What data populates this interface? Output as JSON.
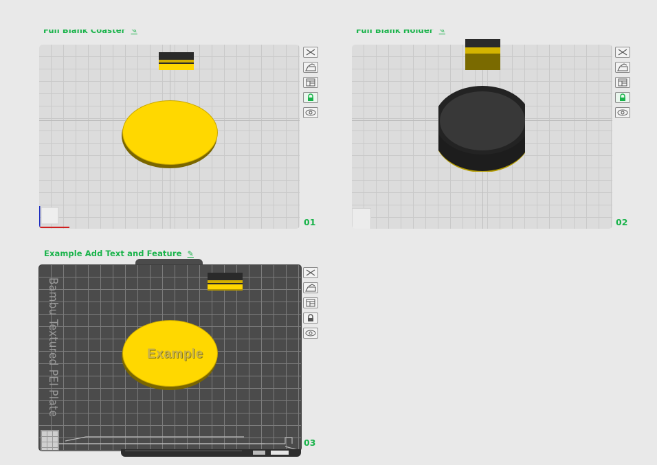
{
  "plates": [
    {
      "name": "Full Blank Coaster",
      "number": "01",
      "object_color": "#ffd700",
      "locked": true
    },
    {
      "name": "Full Blank Holder",
      "number": "02",
      "object_color": "#2e2e2e",
      "locked": true
    },
    {
      "name": "Example Add Text and Feature",
      "number": "03",
      "object_color": "#ffd700",
      "locked": false,
      "bed_label": "Bambu Textured PEI Plate",
      "text_feature": "Example"
    }
  ],
  "toolbar_icons": [
    "close-icon",
    "auto-orient-icon",
    "arrange-icon",
    "lock-icon",
    "eye-icon"
  ],
  "colors": {
    "accent": "#19b34a",
    "filament_yellow": "#ffd700",
    "filament_black": "#2e2e2e"
  }
}
